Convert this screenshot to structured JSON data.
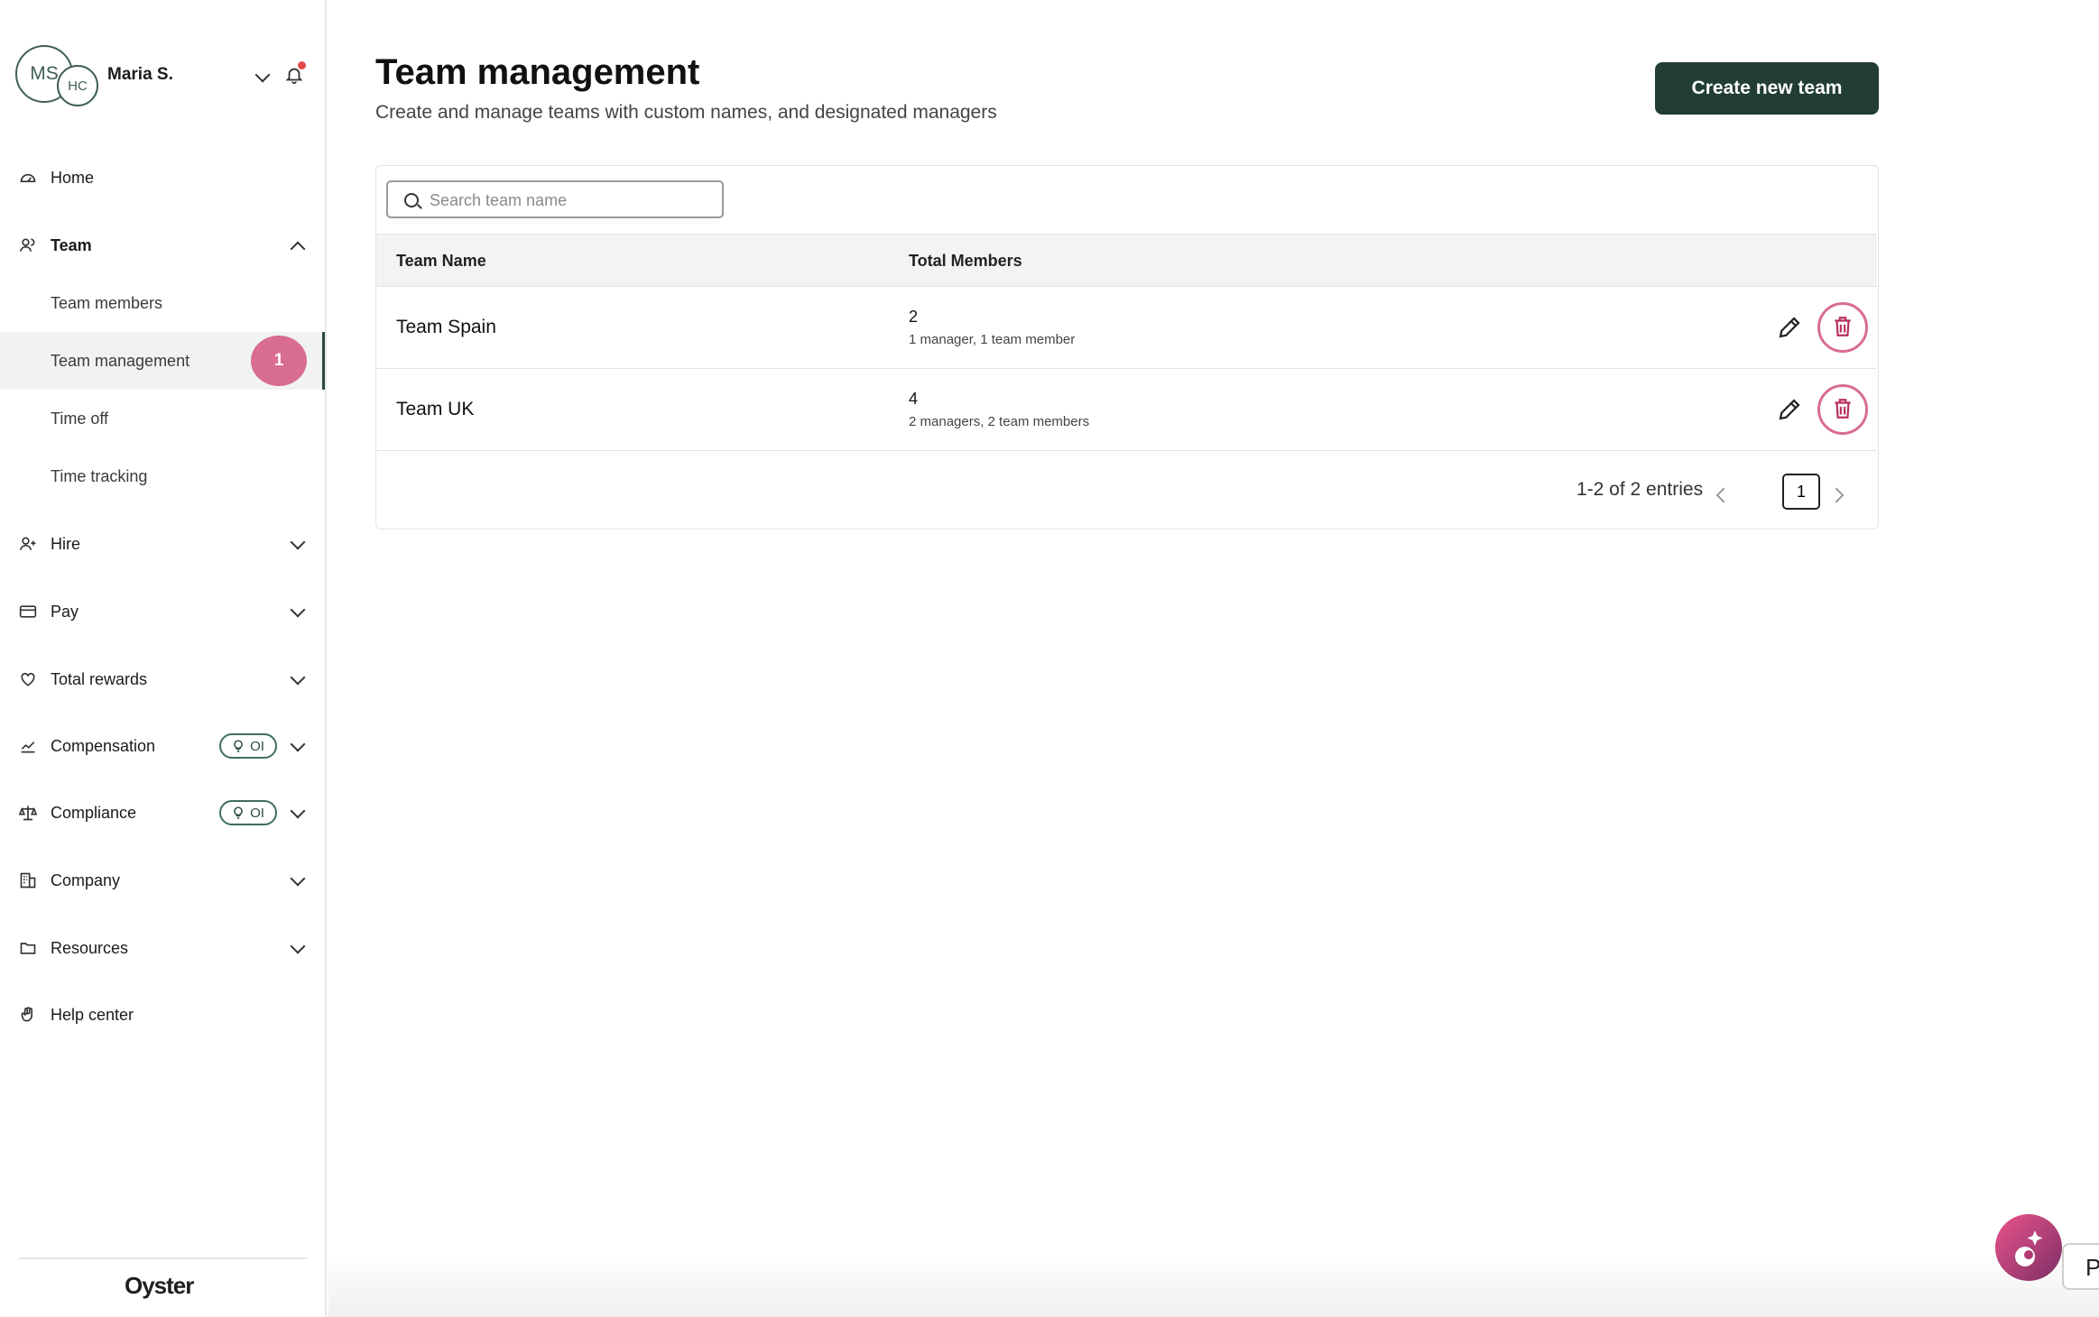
{
  "profile": {
    "initials_primary": "MS",
    "initials_secondary": "HC",
    "name": "Maria S."
  },
  "sidebar": {
    "items": [
      {
        "label": "Home",
        "icon": "dashboard-icon"
      },
      {
        "label": "Team",
        "icon": "team-icon",
        "expanded": true,
        "children": [
          {
            "label": "Team members"
          },
          {
            "label": "Team management",
            "active": true,
            "badge": "1"
          },
          {
            "label": "Time off"
          },
          {
            "label": "Time tracking"
          }
        ]
      },
      {
        "label": "Hire",
        "icon": "hire-icon"
      },
      {
        "label": "Pay",
        "icon": "card-icon"
      },
      {
        "label": "Total rewards",
        "icon": "heart-icon"
      },
      {
        "label": "Compensation",
        "icon": "chart-icon",
        "badge": "OI"
      },
      {
        "label": "Compliance",
        "icon": "scale-icon",
        "badge": "OI"
      },
      {
        "label": "Company",
        "icon": "building-icon"
      },
      {
        "label": "Resources",
        "icon": "folder-icon"
      },
      {
        "label": "Help center",
        "icon": "help-hand-icon"
      }
    ],
    "brand": "Oyster"
  },
  "header": {
    "title": "Team management",
    "subtitle": "Create and manage teams with custom names, and designated managers",
    "create_label": "Create new team"
  },
  "search": {
    "placeholder": "Search team name"
  },
  "table": {
    "columns": [
      "Team Name",
      "Total Members"
    ],
    "rows": [
      {
        "name": "Team Spain",
        "count": "2",
        "detail": "1 manager, 1 team member"
      },
      {
        "name": "Team UK",
        "count": "4",
        "detail": "2 managers, 2 team members"
      }
    ]
  },
  "pagination": {
    "summary": "1-2 of 2 entries",
    "current": "1"
  },
  "side_tab_label": "P",
  "colors": {
    "primary": "#213d34",
    "highlight": "#d96c93",
    "notification": "#e24b4b"
  }
}
